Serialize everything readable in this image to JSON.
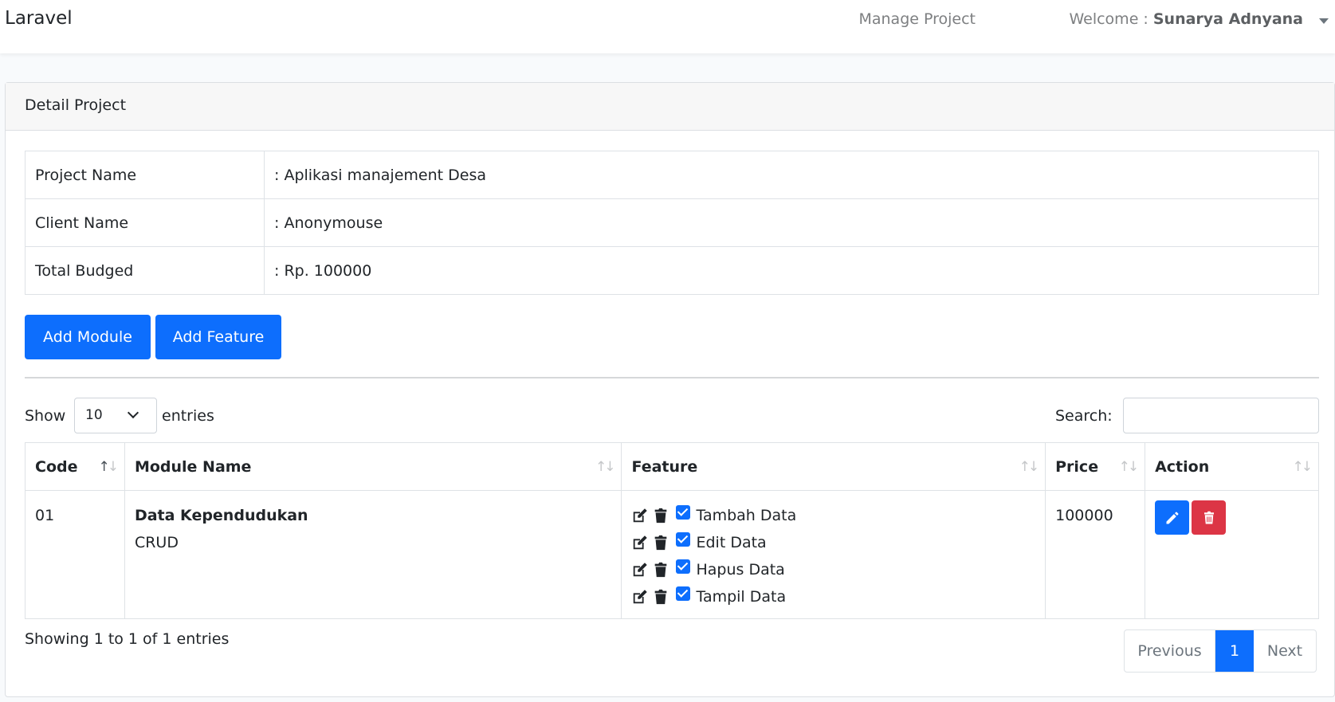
{
  "navbar": {
    "brand": "Laravel",
    "manage_project": "Manage Project",
    "welcome_prefix": "Welcome : ",
    "user_name": "Sunarya Adnyana"
  },
  "card": {
    "title": "Detail Project",
    "details": [
      {
        "label": "Project Name",
        "value": ": Aplikasi manajement Desa"
      },
      {
        "label": "Client Name",
        "value": ": Anonymouse"
      },
      {
        "label": "Total Budged",
        "value": ": Rp. 100000"
      }
    ],
    "add_module": "Add Module",
    "add_feature": "Add Feature"
  },
  "table_controls": {
    "show": "Show",
    "page_length": "10",
    "entries": "entries",
    "search_label": "Search:",
    "search_value": ""
  },
  "table": {
    "columns": [
      "Code",
      "Module Name",
      "Feature",
      "Price",
      "Action"
    ],
    "rows": [
      {
        "code": "01",
        "module_name": "Data Kependudukan",
        "module_sub": "CRUD",
        "features": [
          "Tambah Data",
          "Edit Data",
          "Hapus Data",
          "Tampil Data"
        ],
        "price": "100000"
      }
    ]
  },
  "footer": {
    "info": "Showing 1 to 1 of 1 entries",
    "previous": "Previous",
    "current_page": "1",
    "next": "Next"
  },
  "colors": {
    "primary": "#0d6efd",
    "danger": "#dc3545"
  }
}
